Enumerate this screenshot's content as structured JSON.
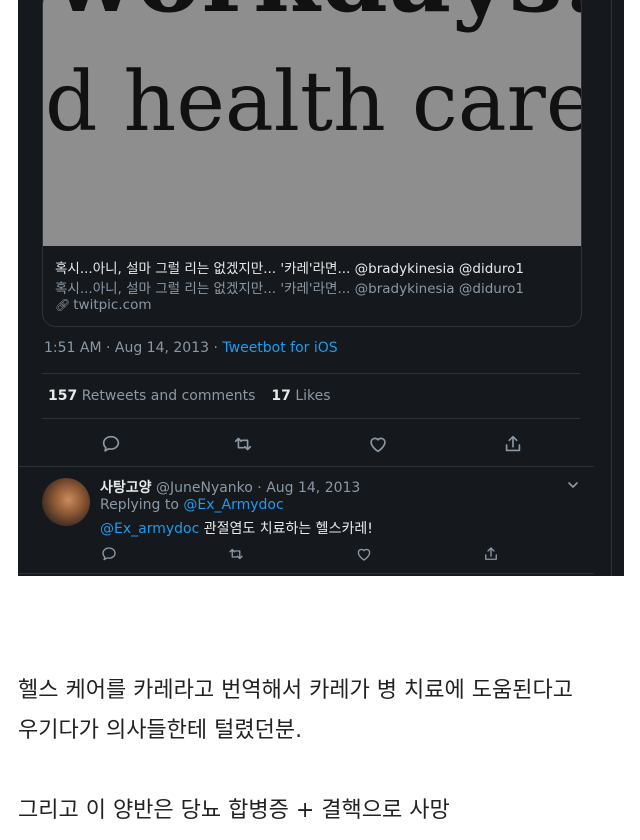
{
  "card": {
    "image_text_top": "workdays. It",
    "image_text_main": "d health care,",
    "title": "혹시...아니, 설마 그럴 리는 없겠지만... '카레'라면... @bradykinesia @diduro1",
    "description": "혹시...아니, 설마 그럴 리는 없겠지만... '카레'라면... @bradykinesia @diduro1",
    "domain": "twitpic.com"
  },
  "tweet_meta": {
    "time_date": "1:51 AM · Aug 14, 2013 · ",
    "app": "Tweetbot for iOS"
  },
  "stats": {
    "retweets_count": "157",
    "retweets_label": "Retweets and comments",
    "likes_count": "17",
    "likes_label": "Likes"
  },
  "reply": {
    "display_name": "사탕고양",
    "handle_date": "@JuneNyanko · Aug 14, 2013",
    "replying_to_label": "Replying to ",
    "replying_to_handle": "@Ex_Armydoc",
    "body_mention": "@Ex_armydoc",
    "body_text": " 관절염도 치료하는 헬스카레!"
  },
  "caption": {
    "line1": "헬스 케어를 카레라고 번역해서 카레가 병 치료에 도움된다고",
    "line2": "우기다가 의사들한테 털렸던분.",
    "line3": "그리고 이 양반은 당뇨 합병증 + 결핵으로 사망"
  },
  "colors": {
    "background": "#15181c",
    "accent": "#1d9bf0",
    "muted": "#8b98a5",
    "text": "#e7e9ea"
  },
  "icons": [
    "link-icon",
    "reply-icon",
    "retweet-icon",
    "like-icon",
    "share-icon",
    "chevron-down-icon"
  ]
}
